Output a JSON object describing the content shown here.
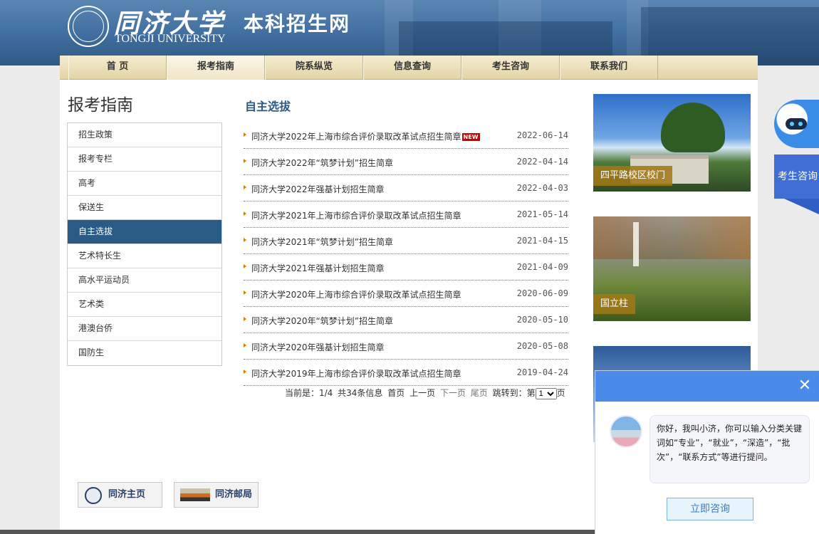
{
  "header": {
    "school_name": "同济大学",
    "school_name_en": "TONGJI UNIVERSITY",
    "site_title": "本科招生网"
  },
  "nav": {
    "items": [
      {
        "label": "首 页"
      },
      {
        "label": "报考指南"
      },
      {
        "label": "院系纵览"
      },
      {
        "label": "信息查询"
      },
      {
        "label": "考生咨询"
      },
      {
        "label": "联系我们"
      }
    ],
    "active": "报考指南"
  },
  "sidebar": {
    "title": "报考指南",
    "items": [
      {
        "label": "招生政策"
      },
      {
        "label": "报考专栏"
      },
      {
        "label": "高考"
      },
      {
        "label": "保送生"
      },
      {
        "label": "自主选拔"
      },
      {
        "label": "艺术特长生"
      },
      {
        "label": "高水平运动员"
      },
      {
        "label": "艺术类"
      },
      {
        "label": "港澳台侨"
      },
      {
        "label": "国防生"
      }
    ],
    "active": "自主选拔"
  },
  "content": {
    "title": "自主选拔",
    "new_badge": "NEW",
    "items": [
      {
        "title": "同济大学2022年上海市综合评价录取改革试点招生简章",
        "date": "2022-06-14"
      },
      {
        "title": "同济大学2022年“筑梦计划”招生简章",
        "date": "2022-04-14"
      },
      {
        "title": "同济大学2022年强基计划招生简章",
        "date": "2022-04-03"
      },
      {
        "title": "同济大学2021年上海市综合评价录取改革试点招生简章",
        "date": "2021-05-14"
      },
      {
        "title": "同济大学2021年“筑梦计划”招生简章",
        "date": "2021-04-15"
      },
      {
        "title": "同济大学2021年强基计划招生简章",
        "date": "2021-04-09"
      },
      {
        "title": "同济大学2020年上海市综合评价录取改革试点招生简章",
        "date": "2020-06-09"
      },
      {
        "title": "同济大学2020年“筑梦计划”招生简章",
        "date": "2020-05-10"
      },
      {
        "title": "同济大学2020年强基计划招生简章",
        "date": "2020-05-08"
      },
      {
        "title": "同济大学2019年上海市综合评价录取改革试点招生简章",
        "date": "2019-04-24"
      }
    ]
  },
  "pager": {
    "current": "当前是：1/4",
    "total": "共34条信息",
    "first": "首页",
    "prev": "上一页",
    "next": "下一页",
    "last": "尾页",
    "jump_label": "跳转到：第",
    "page_value": "1",
    "page_suffix": "页"
  },
  "photos": [
    {
      "caption": "四平路校区校门"
    },
    {
      "caption": "国立柱"
    }
  ],
  "footer": {
    "home_link": "同济主页",
    "mail_link": "同济邮局"
  },
  "float_tab": {
    "label": "考生咨询"
  },
  "chat": {
    "close": "✕",
    "message": "你好，我叫小济，你可以输入分类关键词如“专业”，“就业”，“深造”，“批次”，“联系方式”等进行提问。",
    "button": "立即咨询"
  }
}
